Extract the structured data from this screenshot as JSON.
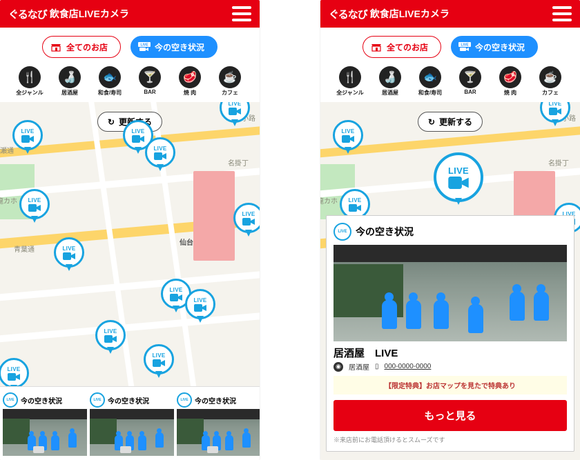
{
  "header": {
    "brand": "ぐるなび",
    "title": "飲食店LIVEカメラ"
  },
  "pills": {
    "all": "全てのお店",
    "availability": "今の空き状況"
  },
  "categories": [
    {
      "name": "all",
      "label": "全ジャンル",
      "glyph": "🍴"
    },
    {
      "name": "izakaya",
      "label": "居酒屋",
      "glyph": "🍶"
    },
    {
      "name": "washoku",
      "label": "和食/寿司",
      "glyph": "🐟"
    },
    {
      "name": "bar",
      "label": "BAR",
      "glyph": "🍸"
    },
    {
      "name": "yakiniku",
      "label": "焼 肉",
      "glyph": "🥩"
    },
    {
      "name": "cafe",
      "label": "カフェ",
      "glyph": "☕"
    }
  ],
  "map": {
    "refresh": "更新する",
    "labels": {
      "aoba": "青葉通",
      "sendai": "仙台",
      "kakecho": "名掛丁",
      "teraji": "寺小路",
      "ryukaho": "龍カホ",
      "hirose": "広瀬通"
    },
    "live_label": "LIVE"
  },
  "cards": {
    "title": "今の空き状況"
  },
  "detail": {
    "title": "今の空き状況",
    "shop_name": "居酒屋　LIVE",
    "category": "居酒屋",
    "phone": "000-0000-0000",
    "promo": "【限定特典】お店マップを見たで特典あり",
    "cta": "もっと見る",
    "note": "※来店前にお電話頂けるとスムーズです"
  }
}
